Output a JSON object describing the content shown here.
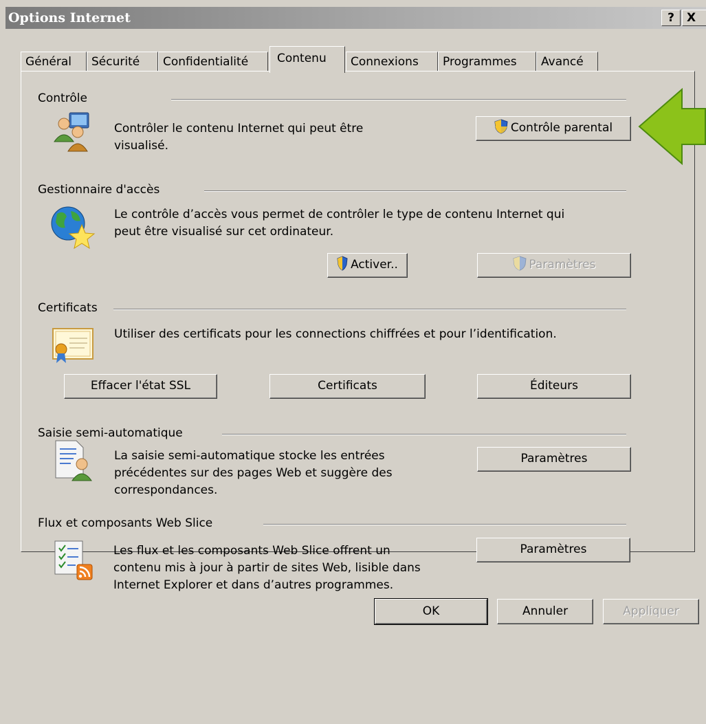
{
  "window": {
    "title": "Options Internet",
    "help_label": "?",
    "close_label": "X"
  },
  "tabs": [
    {
      "label": "Général"
    },
    {
      "label": "Sécurité"
    },
    {
      "label": "Confidentialité"
    },
    {
      "label": "Contenu"
    },
    {
      "label": "Connexions"
    },
    {
      "label": "Programmes"
    },
    {
      "label": "Avancé"
    }
  ],
  "active_tab": "Contenu",
  "sections": {
    "controle": {
      "title": "Contrôle",
      "description_line1": "Contrôler le contenu Internet qui peut être",
      "description_line2": "visualisé.",
      "button": "Contrôle parental"
    },
    "gestionnaire": {
      "title": "Gestionnaire d'accès",
      "description_line1": "Le contrôle d’accès vous permet de contrôler le type de contenu Internet qui",
      "description_line2": "peut être visualisé sur cet ordinateur.",
      "activate_button": "Activer..",
      "settings_button": "Paramètres"
    },
    "certificats": {
      "title": "Certificats",
      "description": "Utiliser des certificats pour les connections chiffrées et pour l’identification.",
      "clear_ssl_button": "Effacer l'état SSL",
      "certificates_button": "Certificats",
      "publishers_button": "Éditeurs"
    },
    "saisie": {
      "title": "Saisie semi-automatique",
      "description_line1": "La saisie semi-automatique stocke les entrées",
      "description_line2": "précédentes sur des pages Web et suggère des",
      "description_line3": "correspondances.",
      "button": "Paramètres"
    },
    "flux": {
      "title": "Flux et composants Web Slice",
      "description_line1": "Les flux et les composants Web Slice offrent un",
      "description_line2": "contenu mis à jour à partir de sites Web, lisible dans",
      "description_line3": "Internet Explorer et dans d’autres programmes.",
      "button": "Paramètres"
    }
  },
  "footer": {
    "ok": "OK",
    "cancel": "Annuler",
    "apply": "Appliquer"
  },
  "colors": {
    "dialog_bg": "#d4d0c8",
    "arrow": "#8cc21a",
    "arrow_outline": "#4d8a0f"
  },
  "icons": [
    "users-computer-icon",
    "globe-star-icon",
    "certificate-icon",
    "form-user-icon",
    "feed-checklist-icon",
    "uac-shield-icon",
    "green-arrow-icon"
  ]
}
